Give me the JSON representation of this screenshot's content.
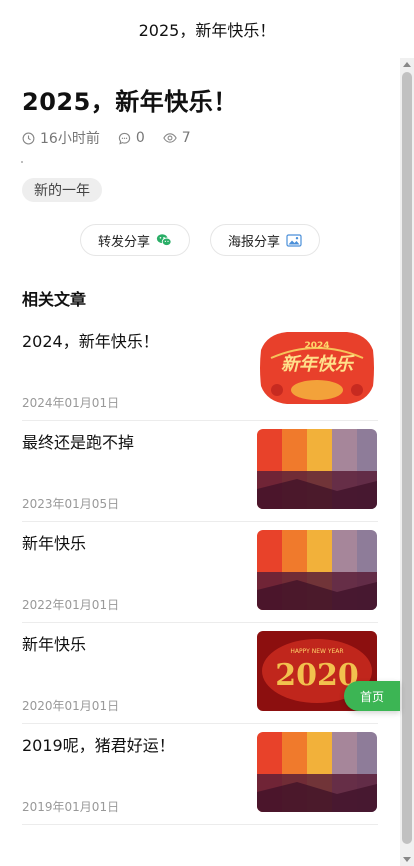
{
  "header": {
    "title": "2025，新年快乐！"
  },
  "article": {
    "title": "2025，新年快乐！",
    "time": "16小时前",
    "comments": "0",
    "views": "7",
    "tag": "新的一年"
  },
  "share": {
    "forward_label": "转发分享",
    "poster_label": "海报分享"
  },
  "related": {
    "heading": "相关文章",
    "items": [
      {
        "title": "2024，新年快乐！",
        "date": "2024年01月01日",
        "thumb": "banner-2024"
      },
      {
        "title": "最终还是跑不掉",
        "date": "2023年01月05日",
        "thumb": "sunset-stripes"
      },
      {
        "title": "新年快乐",
        "date": "2022年01月01日",
        "thumb": "sunset-stripes"
      },
      {
        "title": "新年快乐",
        "date": "2020年01月01日",
        "thumb": "banner-2020"
      },
      {
        "title": "2019呢，猪君好运！",
        "date": "2019年01月01日",
        "thumb": "sunset-stripes"
      }
    ]
  },
  "thumbs": {
    "banner_2024_text": "2024",
    "banner_2024_caption": "新年快乐",
    "banner_2020_text": "2020",
    "banner_2020_caption": "HAPPY NEW YEAR"
  },
  "home_button": "首页",
  "colors": {
    "accent_green": "#3cb554",
    "wechat_green": "#2aae67"
  }
}
